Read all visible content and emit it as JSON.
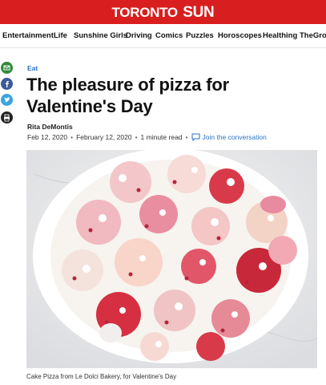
{
  "header": {
    "logo_part1": "TORONTO",
    "logo_part2": "SUN",
    "brand_color": "#d81e1e"
  },
  "nav": {
    "items": [
      "Entertainment",
      "Life",
      "Sunshine Girls",
      "Driving",
      "Comics",
      "Puzzles",
      "Horoscopes",
      "Healthing",
      "TheGrow"
    ]
  },
  "share": {
    "icons": [
      "email-icon",
      "facebook-icon",
      "twitter-icon",
      "print-icon"
    ]
  },
  "article": {
    "category": "Eat",
    "title": "The pleasure of pizza for Valentine's Day",
    "author": "Rita DeMontis",
    "published": "Feb 12, 2020",
    "updated": "February 12, 2020",
    "read_time": "1 minute read",
    "comments_link": "Join the conversation",
    "caption": "Cake Pizza from Le Dolci Bakery, for Valentine's Day"
  },
  "colors": {
    "link": "#2a73c5",
    "accent_red": "#d81e1e"
  }
}
